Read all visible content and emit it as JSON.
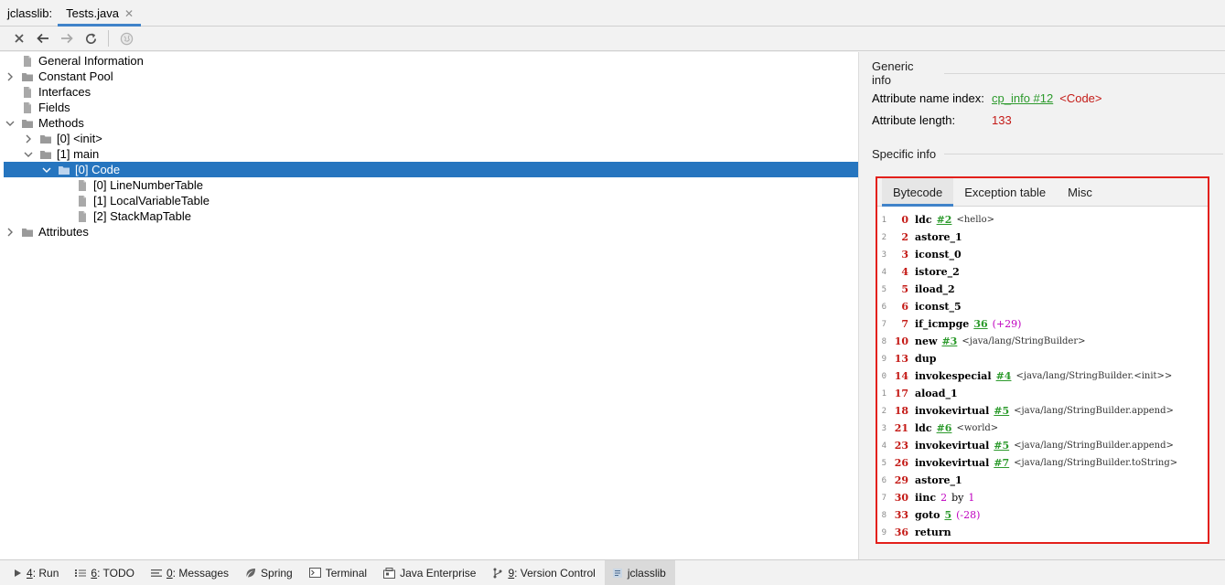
{
  "tabbar": {
    "tool_title": "jclasslib:",
    "active_tab": "Tests.java"
  },
  "tree": [
    {
      "label": "General Information",
      "arrow": "",
      "depth": 0,
      "icon": "file-icon"
    },
    {
      "label": "Constant Pool",
      "arrow": "›",
      "depth": 0,
      "icon": "folder-icon"
    },
    {
      "label": "Interfaces",
      "arrow": "",
      "depth": 0,
      "icon": "file-icon"
    },
    {
      "label": "Fields",
      "arrow": "",
      "depth": 0,
      "icon": "file-icon"
    },
    {
      "label": "Methods",
      "arrow": "⌄",
      "depth": 0,
      "icon": "folder-icon"
    },
    {
      "label": "[0] <init>",
      "arrow": "›",
      "depth": 1,
      "icon": "folder-icon"
    },
    {
      "label": "[1] main",
      "arrow": "⌄",
      "depth": 1,
      "icon": "folder-icon"
    },
    {
      "label": "[0] Code",
      "arrow": "⌄",
      "depth": 2,
      "icon": "folder-icon",
      "selected": true
    },
    {
      "label": "[0] LineNumberTable",
      "arrow": "",
      "depth": 3,
      "icon": "file-icon"
    },
    {
      "label": "[1] LocalVariableTable",
      "arrow": "",
      "depth": 3,
      "icon": "file-icon"
    },
    {
      "label": "[2] StackMapTable",
      "arrow": "",
      "depth": 3,
      "icon": "file-icon"
    },
    {
      "label": "Attributes",
      "arrow": "›",
      "depth": 0,
      "icon": "folder-icon"
    }
  ],
  "generic": {
    "title": "Generic info",
    "name_index_label": "Attribute name index:",
    "name_index_link": "cp_info #12",
    "name_index_value": "<Code>",
    "length_label": "Attribute length:",
    "length_value": "133"
  },
  "specific": {
    "title": "Specific info",
    "tabs": [
      "Bytecode",
      "Exception table",
      "Misc"
    ]
  },
  "bytecode": [
    {
      "ln": "1",
      "off": "0",
      "op": "ldc",
      "ref": "#2",
      "cm": "<hello>"
    },
    {
      "ln": "2",
      "off": "2",
      "op": "astore_1"
    },
    {
      "ln": "3",
      "off": "3",
      "op": "iconst_0"
    },
    {
      "ln": "4",
      "off": "4",
      "op": "istore_2"
    },
    {
      "ln": "5",
      "off": "5",
      "op": "iload_2"
    },
    {
      "ln": "6",
      "off": "6",
      "op": "iconst_5"
    },
    {
      "ln": "7",
      "off": "7",
      "op": "if_icmpge",
      "ref": "36",
      "num": "(+29)"
    },
    {
      "ln": "8",
      "off": "10",
      "op": "new",
      "ref": "#3",
      "cm": "<java/lang/StringBuilder>"
    },
    {
      "ln": "9",
      "off": "13",
      "op": "dup"
    },
    {
      "ln": "0",
      "off": "14",
      "op": "invokespecial",
      "ref": "#4",
      "cm": "<java/lang/StringBuilder.<init>>"
    },
    {
      "ln": "1",
      "off": "17",
      "op": "aload_1"
    },
    {
      "ln": "2",
      "off": "18",
      "op": "invokevirtual",
      "ref": "#5",
      "cm": "<java/lang/StringBuilder.append>"
    },
    {
      "ln": "3",
      "off": "21",
      "op": "ldc",
      "ref": "#6",
      "cm": "<world>"
    },
    {
      "ln": "4",
      "off": "23",
      "op": "invokevirtual",
      "ref": "#5",
      "cm": "<java/lang/StringBuilder.append>"
    },
    {
      "ln": "5",
      "off": "26",
      "op": "invokevirtual",
      "ref": "#7",
      "cm": "<java/lang/StringBuilder.toString>"
    },
    {
      "ln": "6",
      "off": "29",
      "op": "astore_1"
    },
    {
      "ln": "7",
      "off": "30",
      "op": "iinc",
      "num": "2",
      "kw": "by",
      "num2": "1"
    },
    {
      "ln": "8",
      "off": "33",
      "op": "goto",
      "ref": "5",
      "num": "(-28)"
    },
    {
      "ln": "9",
      "off": "36",
      "op": "return"
    }
  ],
  "bottombar": [
    {
      "key": "4",
      "rest": ": Run",
      "icon": "run-icon"
    },
    {
      "key": "6",
      "rest": ": TODO",
      "icon": "todo-icon"
    },
    {
      "key": "0",
      "rest": ": Messages",
      "icon": "messages-icon"
    },
    {
      "key": "",
      "rest": "Spring",
      "icon": "spring-icon"
    },
    {
      "key": "",
      "rest": "Terminal",
      "icon": "terminal-icon"
    },
    {
      "key": "",
      "rest": "Java Enterprise",
      "icon": "java-enterprise-icon"
    },
    {
      "key": "9",
      "rest": ": Version Control",
      "icon": "version-control-icon"
    },
    {
      "key": "",
      "rest": "jclasslib",
      "icon": "jclasslib-icon",
      "active": true
    }
  ],
  "colors": {
    "accent": "#4083c9",
    "selection": "#2675bf",
    "highlight_border": "#e3201b",
    "link": "#2c9a2c",
    "value_red": "#c41a16"
  }
}
